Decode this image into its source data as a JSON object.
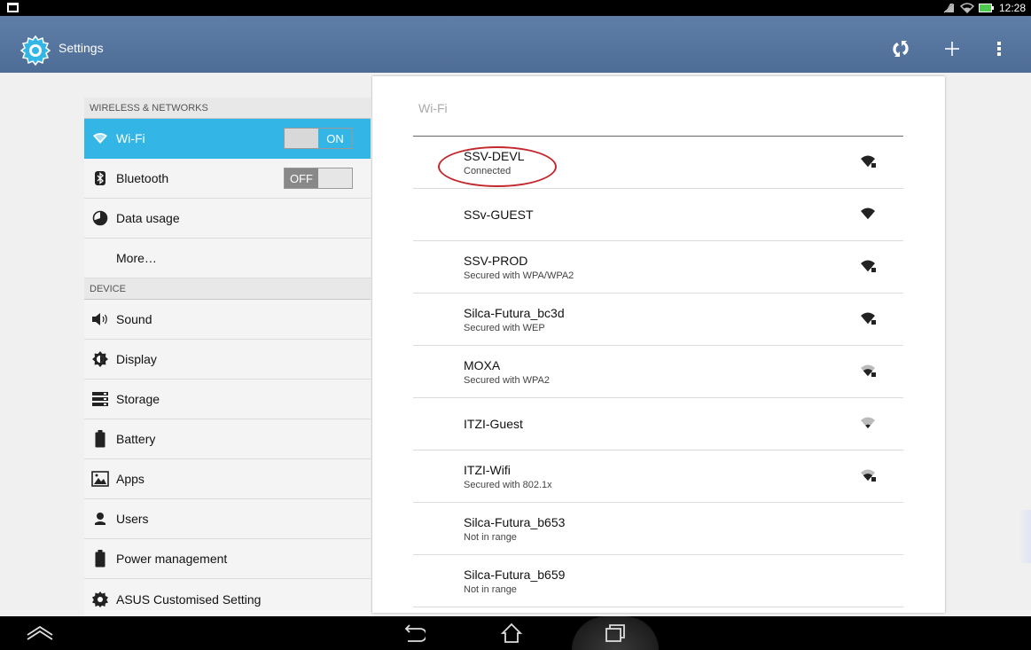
{
  "status_bar": {
    "time": "12:28",
    "icons": [
      "gallery-icon",
      "no-sim-icon",
      "wifi-icon",
      "battery-icon"
    ]
  },
  "action_bar": {
    "title": "Settings",
    "actions": [
      "sync-icon",
      "add-icon",
      "overflow-menu-icon"
    ]
  },
  "left_menu": {
    "sections": [
      {
        "header": "WIRELESS & NETWORKS",
        "items": [
          {
            "label": "Wi-Fi",
            "icon": "wifi-icon",
            "toggle": "ON",
            "active": true
          },
          {
            "label": "Bluetooth",
            "icon": "bluetooth-icon",
            "toggle": "OFF"
          },
          {
            "label": "Data usage",
            "icon": "data-usage-icon"
          },
          {
            "label": "More…"
          }
        ]
      },
      {
        "header": "DEVICE",
        "items": [
          {
            "label": "Sound",
            "icon": "speaker-icon"
          },
          {
            "label": "Display",
            "icon": "brightness-icon"
          },
          {
            "label": "Storage",
            "icon": "storage-icon"
          },
          {
            "label": "Battery",
            "icon": "battery-icon"
          },
          {
            "label": "Apps",
            "icon": "apps-icon"
          },
          {
            "label": "Users",
            "icon": "user-icon"
          },
          {
            "label": "Power management",
            "icon": "battery-icon"
          },
          {
            "label": "ASUS Customised Setting",
            "icon": "gear-icon"
          }
        ]
      }
    ]
  },
  "wifi_panel": {
    "title": "Wi-Fi",
    "networks": [
      {
        "ssid": "SSV-DEVL",
        "status": "Connected",
        "signal": "locked-strong"
      },
      {
        "ssid": "SSv-GUEST",
        "status": "",
        "signal": "open-strong"
      },
      {
        "ssid": "SSV-PROD",
        "status": "Secured with WPA/WPA2",
        "signal": "locked-strong"
      },
      {
        "ssid": "Silca-Futura_bc3d",
        "status": "Secured with WEP",
        "signal": "locked-strong"
      },
      {
        "ssid": "MOXA",
        "status": "Secured with WPA2",
        "signal": "locked-medium"
      },
      {
        "ssid": "ITZI-Guest",
        "status": "",
        "signal": "open-weak"
      },
      {
        "ssid": "ITZI-Wifi",
        "status": "Secured with 802.1x",
        "signal": "locked-medium"
      },
      {
        "ssid": "Silca-Futura_b653",
        "status": "Not in range",
        "signal": "none"
      },
      {
        "ssid": "Silca-Futura_b659",
        "status": "Not in range",
        "signal": "none"
      }
    ]
  },
  "nav_bar": {
    "buttons": [
      "up-arrow-icon",
      "back-icon",
      "home-icon",
      "recent-apps-icon"
    ]
  },
  "colors": {
    "accent": "#33b5e5",
    "action_bar": "#5677a1",
    "annotation": "#c2282d"
  }
}
